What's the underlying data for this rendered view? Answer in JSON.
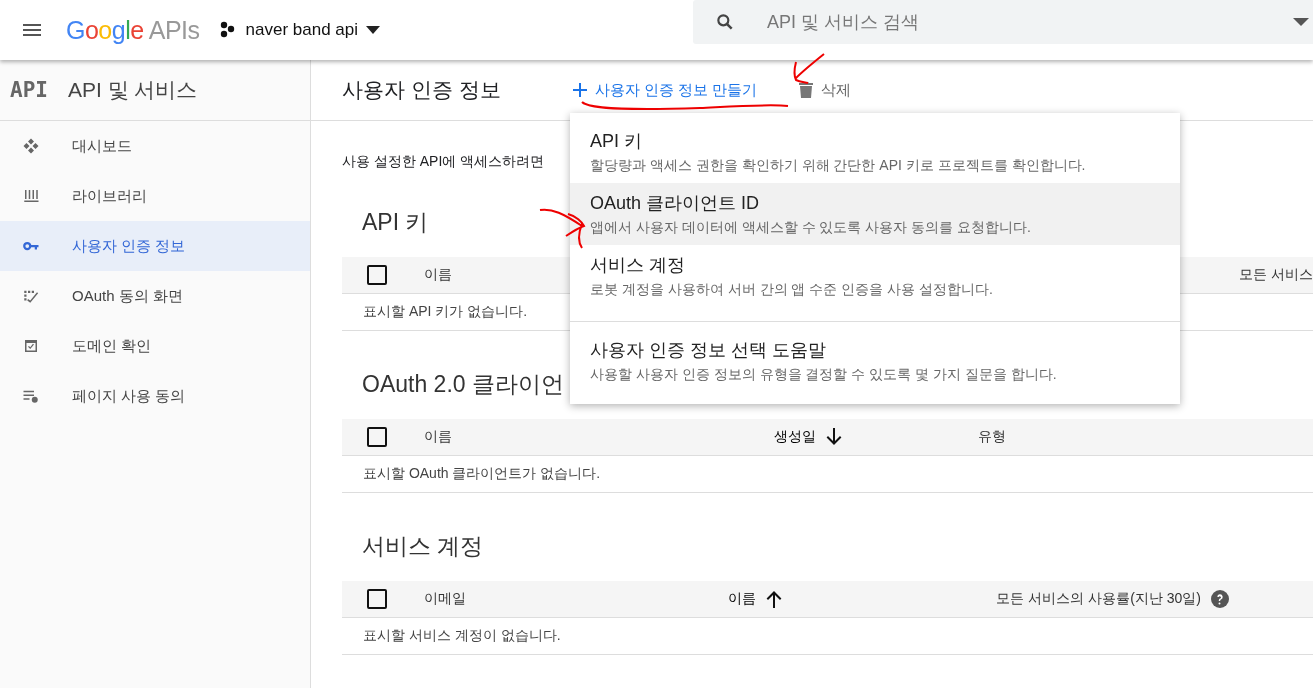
{
  "header": {
    "logo_brand": "Google",
    "logo_product": "APIs",
    "project": "naver band api",
    "search": {
      "placeholder": "API 및 서비스 검색"
    }
  },
  "sidebar": {
    "badge": "API",
    "title": "API 및 서비스",
    "items": [
      {
        "label": "대시보드",
        "selected": false
      },
      {
        "label": "라이브러리",
        "selected": false
      },
      {
        "label": "사용자 인증 정보",
        "selected": true
      },
      {
        "label": "OAuth 동의 화면",
        "selected": false
      },
      {
        "label": "도메인 확인",
        "selected": false
      },
      {
        "label": "페이지 사용 동의",
        "selected": false
      }
    ]
  },
  "page": {
    "title": "사용자 인증 정보",
    "toolbar": [
      {
        "kind": "create",
        "label": "사용자 인증 정보 만들기"
      },
      {
        "kind": "delete",
        "label": "삭제"
      }
    ],
    "intro": "사용 설정한 API에 액세스하려면",
    "sections": [
      {
        "title": "API 키",
        "all_checked": false,
        "columns": [
          {
            "label": "이름",
            "sorted": false
          },
          {
            "label": "모든 서비스",
            "sorted": false
          }
        ],
        "empty": "표시할 API 키가 없습니다."
      },
      {
        "title": "OAuth 2.0 클라이언",
        "all_checked": false,
        "columns": [
          {
            "label": "이름",
            "sorted": false
          },
          {
            "label": "생성일",
            "sorted": true,
            "ascending": false
          },
          {
            "label": "유형",
            "sorted": false
          }
        ],
        "empty": "표시할 OAuth 클라이언트가 없습니다."
      },
      {
        "title": "서비스 계정",
        "all_checked": false,
        "columns": [
          {
            "label": "이메일",
            "sorted": false
          },
          {
            "label": "이름",
            "sorted": true,
            "ascending": true
          },
          {
            "label": "모든 서비스의 사용률(지난 30일)",
            "sorted": false,
            "help": true
          }
        ],
        "empty": "표시할 서비스 계정이 없습니다."
      }
    ]
  },
  "menu": {
    "items": [
      {
        "title": "API 키",
        "description": "할당량과 액세스 권한을 확인하기 위해 간단한 API 키로 프로젝트를 확인합니다.",
        "highlighted": false,
        "separated": false
      },
      {
        "title": "OAuth 클라이언트 ID",
        "description": "앱에서 사용자 데이터에 액세스할 수 있도록 사용자 동의를 요청합니다.",
        "highlighted": true,
        "separated": false
      },
      {
        "title": "서비스 계정",
        "description": "로봇 계정을 사용하여 서버 간의 앱 수준 인증을 사용 설정합니다.",
        "highlighted": false,
        "separated": false
      },
      {
        "title": "사용자 인증 정보 선택 도움말",
        "description": "사용할 사용자 인증 정보의 유형을 결정할 수 있도록 몇 가지 질문을 합니다.",
        "highlighted": false,
        "separated": true
      }
    ]
  }
}
